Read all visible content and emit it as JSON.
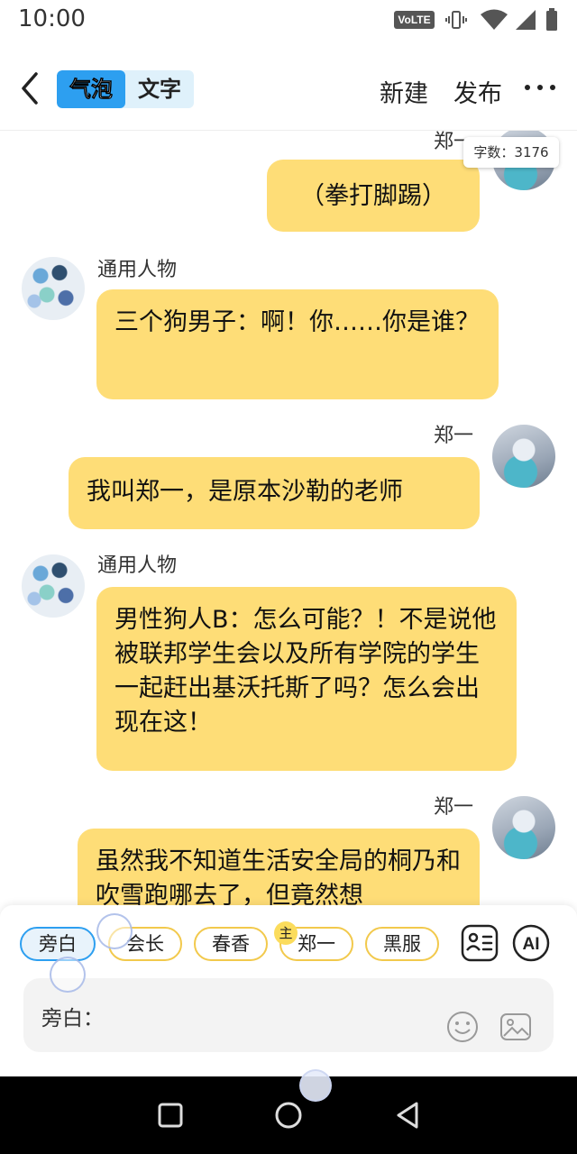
{
  "status_bar": {
    "time": "10:00",
    "network_badge": "VoLTE"
  },
  "header": {
    "tabs": [
      {
        "label": "气泡",
        "active": true
      },
      {
        "label": "文字",
        "active": false
      }
    ],
    "new_label": "新建",
    "publish_label": "发布"
  },
  "word_count": "字数：3176",
  "messages": [
    {
      "speaker": "郑一",
      "text": "（拳打脚踢）",
      "side": "right"
    },
    {
      "speaker": "通用人物",
      "text": "三个狗男子：啊！你……你是谁？",
      "side": "left"
    },
    {
      "speaker": "郑一",
      "text": "我叫郑一，是原本沙勒的老师",
      "side": "right"
    },
    {
      "speaker": "通用人物",
      "text": "男性狗人B：怎么可能？！不是说他被联邦学生会以及所有学院的学生一起赶出基沃托斯了吗？怎么会出现在这！",
      "side": "left"
    },
    {
      "speaker": "郑一",
      "text": "虽然我不知道生活安全局的桐乃和吹雪跑哪去了，但竟然想",
      "side": "right"
    }
  ],
  "characters": [
    {
      "label": "旁白",
      "active": true
    },
    {
      "label": "会长",
      "active": false
    },
    {
      "label": "春香",
      "active": false
    },
    {
      "label": "郑一",
      "active": false,
      "badge": "主"
    },
    {
      "label": "黑服",
      "active": false
    }
  ],
  "tools": {
    "ai_label": "AI",
    "character_icon": "contact-card-icon",
    "emoji_icon": "emoji-icon",
    "image_icon": "image-icon"
  },
  "input": {
    "prefix": "旁白："
  },
  "colors": {
    "bubble": "#fedd77",
    "accent": "#2d9ff0",
    "chip_border": "#f2c94c"
  }
}
